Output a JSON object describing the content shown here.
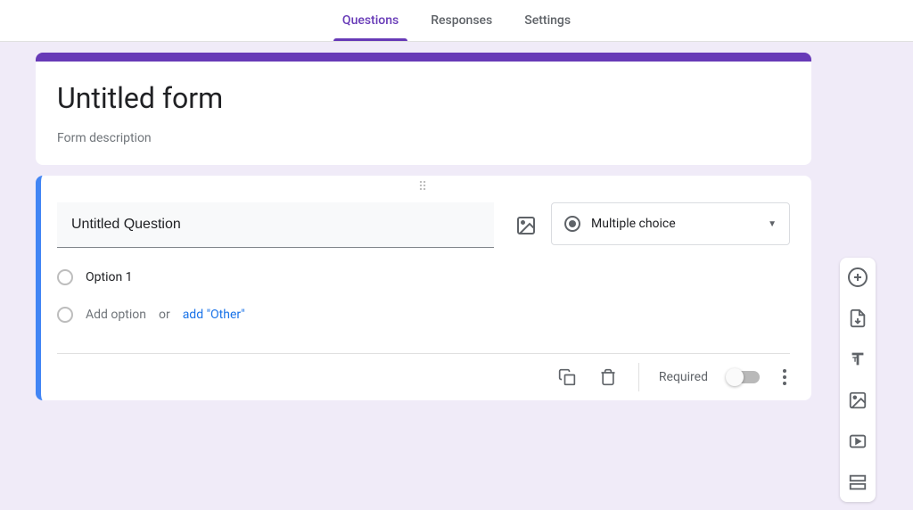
{
  "tabs": {
    "questions": "Questions",
    "responses": "Responses",
    "settings": "Settings"
  },
  "header": {
    "title": "Untitled form",
    "description": "Form description"
  },
  "question": {
    "title": "Untitled Question",
    "type_label": "Multiple choice",
    "option1": "Option 1",
    "add_option": "Add option",
    "or": "or",
    "add_other": "add \"Other\""
  },
  "footer": {
    "required": "Required"
  }
}
